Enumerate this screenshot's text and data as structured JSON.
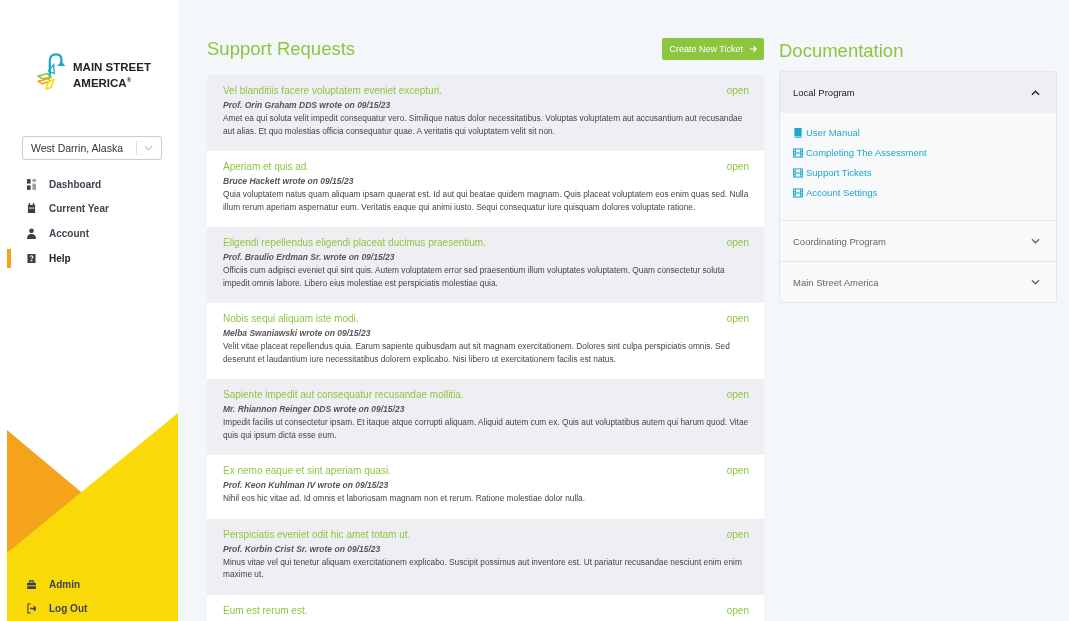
{
  "sidebar": {
    "logo": {
      "line1": "MAIN STREET",
      "line2": "AMERICA",
      "mark": "®"
    },
    "location_select": {
      "value": "West Darrin, Alaska"
    },
    "nav_items": [
      {
        "label": "Dashboard",
        "selected": false
      },
      {
        "label": "Current Year",
        "selected": false
      },
      {
        "label": "Account",
        "selected": false
      },
      {
        "label": "Help",
        "selected": true
      }
    ],
    "footer_items": [
      {
        "label": "Admin"
      },
      {
        "label": "Log Out"
      }
    ]
  },
  "support": {
    "title": "Support Requests",
    "create_button": "Create New Ticket",
    "tickets": [
      {
        "title": "Vel blanditiis facere voluptatem eveniet excepturi.",
        "status": "open",
        "author": "Prof. Orin Graham DDS wrote on 09/15/23",
        "body": "Amet ea qui soluta velit impedit consequatur vero. Similique natus dolor necessitatibus. Voluptas voluptatem aut accusantium aut recusandae aut alias. Et quo molestias officia consequatur quae. A veritatis qui voluptatem velit sit non."
      },
      {
        "title": "Aperiam et quis ad.",
        "status": "open",
        "author": "Bruce Hackett wrote on 09/15/23",
        "body": "Quia voluptatem natus quam aliquam ipsam quaerat est. Id aut qui beatae quidem magnam. Quis placeat voluptatem eos enim quas sed. Nulla illum rerum aperiam aspernatur eum. Veritatis eaque qui animi iusto. Sequi consequatur iure quisquam dolores voluptate ratione."
      },
      {
        "title": "Eligendi repellendus eligendi placeat ducimus praesentium.",
        "status": "open",
        "author": "Prof. Braulio Erdman Sr. wrote on 09/15/23",
        "body": "Officiis cum adipisci eveniet qui sint quis. Autem voluptatem error sed praesentium illum voluptates voluptatem. Quam consectetur soluta impedit omnis labore. Libero eius molestiae est perspiciatis molestiae quia."
      },
      {
        "title": "Nobis sequi aliquam iste modi.",
        "status": "open",
        "author": "Melba Swaniawski wrote on 09/15/23",
        "body": "Velit vitae placeat repellendus quia. Earum sapiente quibusdam aut sit magnam exercitationem. Dolores sint culpa perspiciatis omnis. Sed deserunt et laudantium iure necessitatibus dolorem explicabo. Nisi libero ut exercitationem facilis est natus."
      },
      {
        "title": "Sapiente impedit aut consequatur recusandae mollitia.",
        "status": "open",
        "author": "Mr. Rhiannon Reinger DDS wrote on 09/15/23",
        "body": "Impedit facilis ut consectetur ipsam. Et itaque atque corrupti aliquam. Aliquid autem cum ex. Quis aut voluptatibus autem qui harum quod. Vitae quis qui ipsum dicta esse eum."
      },
      {
        "title": "Ex nemo eaque et sint aperiam quasi.",
        "status": "open",
        "author": "Prof. Keon Kuhlman IV wrote on 09/15/23",
        "body": "Nihil eos hic vitae ad. Id omnis et laboriosam magnam non et rerum. Ratione molestiae dolor nulla."
      },
      {
        "title": "Perspiciatis eveniet odit hic amet totam ut.",
        "status": "open",
        "author": "Prof. Korbin Crist Sr. wrote on 09/15/23",
        "body": "Minus vitae vel qui tenetur aliquam exercitationem explicabo. Suscipit possimus aut inventore est. Ut pariatur recusandae nesciunt enim enim maxime ut."
      },
      {
        "title": "Eum est rerum est.",
        "status": "open"
      }
    ]
  },
  "documentation": {
    "title": "Documentation",
    "sections": [
      {
        "label": "Local Program",
        "expanded": true,
        "links": [
          {
            "label": "User Manual",
            "kind": "book"
          },
          {
            "label": "Completing The Assessment",
            "kind": "video"
          },
          {
            "label": "Support Tickets",
            "kind": "video"
          },
          {
            "label": "Account Settings",
            "kind": "video"
          }
        ]
      },
      {
        "label": "Coordinating Program",
        "expanded": false
      },
      {
        "label": "Main Street America",
        "expanded": false
      }
    ]
  }
}
